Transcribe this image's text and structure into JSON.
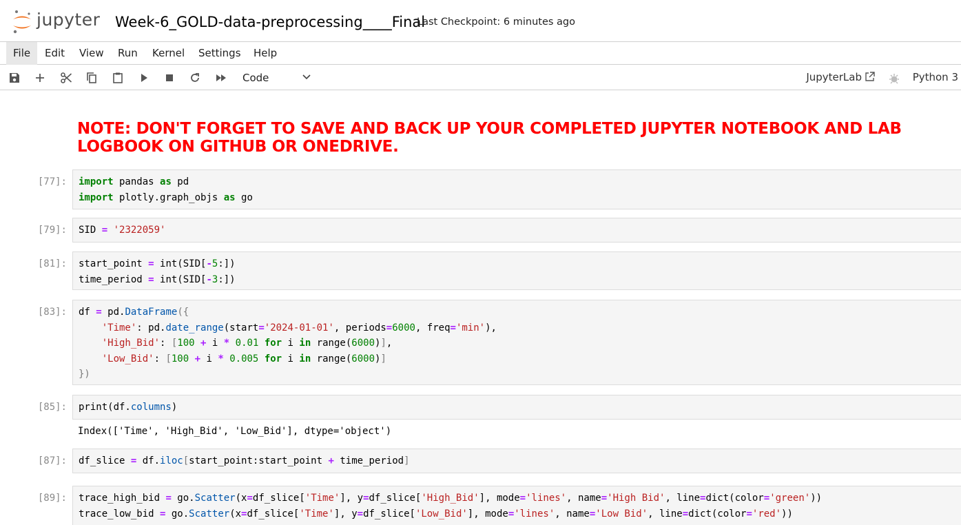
{
  "app": {
    "logo_text": "jupyter",
    "notebook_title": "Week-6_GOLD-data-preprocessing____Final",
    "checkpoint": "Last Checkpoint: 6 minutes ago"
  },
  "menu": [
    "File",
    "Edit",
    "View",
    "Run",
    "Kernel",
    "Settings",
    "Help"
  ],
  "toolbar": {
    "cell_type": "Code",
    "jupyterlab_link": "JupyterLab",
    "kernel_name": "Python 3",
    "icons": [
      "save-icon",
      "add-cell-icon",
      "cut-icon",
      "copy-icon",
      "paste-icon",
      "run-icon",
      "stop-icon",
      "restart-icon",
      "fast-forward-icon"
    ]
  },
  "note": "NOTE: DON'T FORGET TO SAVE AND BACK UP YOUR COMPLETED JUPYTER NOTEBOOK AND LAB LOGBOOK ON GITHUB OR ONEDRIVE.",
  "cells": [
    {
      "prompt": "[77]:",
      "lines": [
        "import pandas as pd",
        "import plotly.graph_objs as go"
      ]
    },
    {
      "prompt": "[79]:",
      "lines": [
        "SID = '2322059'"
      ]
    },
    {
      "prompt": "[81]:",
      "lines": [
        "start_point = int(SID[-5:])",
        "time_period = int(SID[-3:])"
      ]
    },
    {
      "prompt": "[83]:",
      "lines": [
        "df = pd.DataFrame({",
        "    'Time': pd.date_range(start='2024-01-01', periods=6000, freq='min'),",
        "    'High_Bid': [100 + i * 0.01 for i in range(6000)],",
        "    'Low_Bid': [100 + i * 0.005 for i in range(6000)]",
        "})"
      ]
    },
    {
      "prompt": "[85]:",
      "lines": [
        "print(df.columns)"
      ],
      "output": "Index(['Time', 'High_Bid', 'Low_Bid'], dtype='object')"
    },
    {
      "prompt": "[87]:",
      "lines": [
        "df_slice = df.iloc[start_point:start_point + time_period]"
      ]
    },
    {
      "prompt": "[89]:",
      "lines": [
        "trace_high_bid = go.Scatter(x=df_slice['Time'], y=df_slice['High_Bid'], mode='lines', name='High Bid', line=dict(color='green'))",
        "trace_low_bid = go.Scatter(x=df_slice['Time'], y=df_slice['Low_Bid'], mode='lines', name='Low Bid', line=dict(color='red'))"
      ]
    }
  ],
  "colors": {
    "note": "#ff0000",
    "keyword": "#008000",
    "string": "#ba2121",
    "operator": "#aa22ff"
  }
}
